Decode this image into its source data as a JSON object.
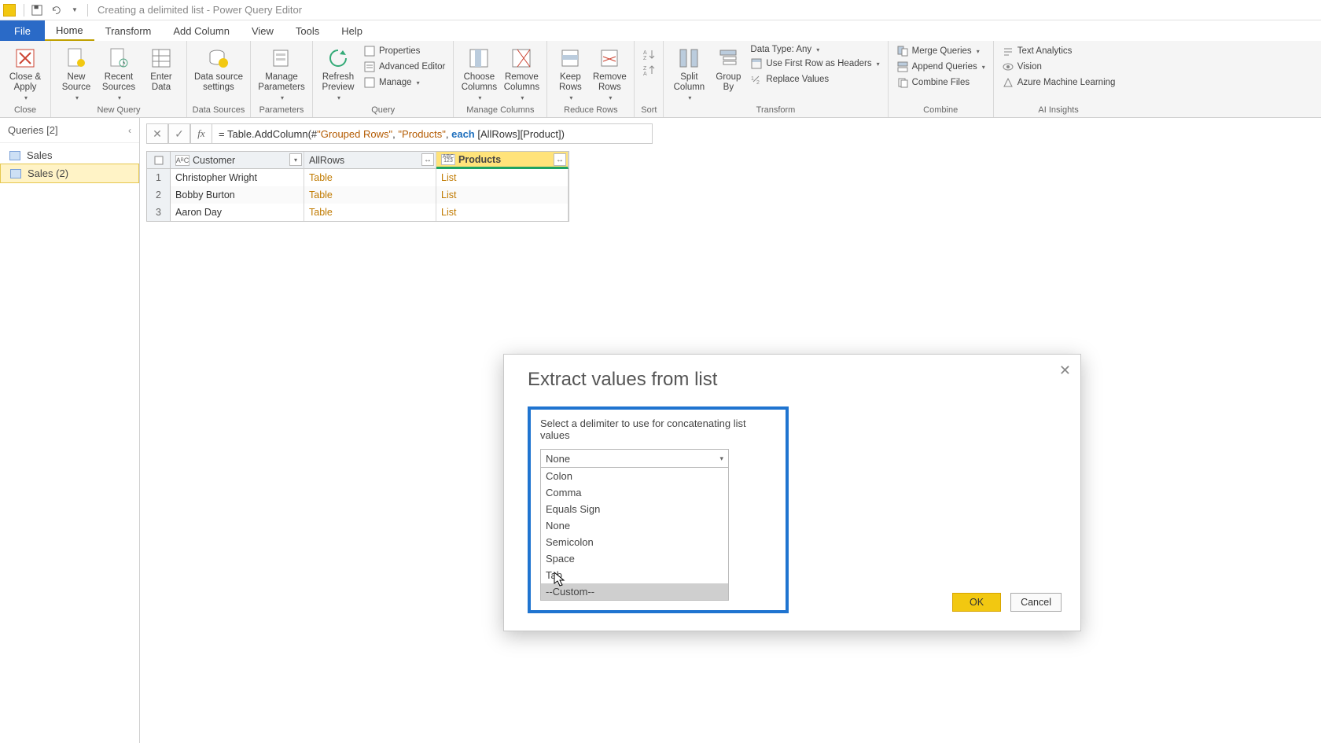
{
  "window": {
    "title": "Creating a delimited list - Power Query Editor"
  },
  "tabs": {
    "file": "File",
    "home": "Home",
    "transform": "Transform",
    "add_column": "Add Column",
    "view": "View",
    "tools": "Tools",
    "help": "Help"
  },
  "ribbon": {
    "close": {
      "close_apply": "Close &\nApply",
      "group": "Close"
    },
    "new_query": {
      "new_source": "New\nSource",
      "recent_sources": "Recent\nSources",
      "enter_data": "Enter\nData",
      "group": "New Query"
    },
    "data_sources": {
      "data_source_settings": "Data source\nsettings",
      "group": "Data Sources"
    },
    "parameters": {
      "manage_parameters": "Manage\nParameters",
      "group": "Parameters"
    },
    "query": {
      "refresh_preview": "Refresh\nPreview",
      "properties": "Properties",
      "advanced_editor": "Advanced Editor",
      "manage": "Manage",
      "group": "Query"
    },
    "manage_columns": {
      "choose_columns": "Choose\nColumns",
      "remove_columns": "Remove\nColumns",
      "group": "Manage Columns"
    },
    "reduce_rows": {
      "keep_rows": "Keep\nRows",
      "remove_rows": "Remove\nRows",
      "group": "Reduce Rows"
    },
    "sort": {
      "group": "Sort"
    },
    "transform": {
      "split_column": "Split\nColumn",
      "group_by": "Group\nBy",
      "data_type": "Data Type: Any",
      "first_row_headers": "Use First Row as Headers",
      "replace_values": "Replace Values",
      "group": "Transform"
    },
    "combine": {
      "merge_queries": "Merge Queries",
      "append_queries": "Append Queries",
      "combine_files": "Combine Files",
      "group": "Combine"
    },
    "ai": {
      "text_analytics": "Text Analytics",
      "vision": "Vision",
      "azure_ml": "Azure Machine Learning",
      "group": "AI Insights"
    }
  },
  "queries_pane": {
    "header": "Queries [2]",
    "items": [
      "Sales",
      "Sales (2)"
    ]
  },
  "formula": {
    "prefix": "= Table.AddColumn(#",
    "arg1": "\"Grouped Rows\"",
    "sep1": ", ",
    "arg2": "\"Products\"",
    "sep2": ", ",
    "kw": "each",
    "tail": " [AllRows][Product])"
  },
  "table": {
    "columns": {
      "customer": "Customer",
      "allrows": "AllRows",
      "products": "Products"
    },
    "type_badges": {
      "customer": "ABC",
      "products": "ABC\n123"
    },
    "rows": [
      {
        "n": "1",
        "customer": "Christopher Wright",
        "allrows": "Table",
        "products": "List"
      },
      {
        "n": "2",
        "customer": "Bobby Burton",
        "allrows": "Table",
        "products": "List"
      },
      {
        "n": "3",
        "customer": "Aaron Day",
        "allrows": "Table",
        "products": "List"
      }
    ]
  },
  "dialog": {
    "title": "Extract values from list",
    "prompt": "Select a delimiter to use for concatenating list values",
    "selected": "None",
    "options": [
      "Colon",
      "Comma",
      "Equals Sign",
      "None",
      "Semicolon",
      "Space",
      "Tab",
      "--Custom--"
    ],
    "ok": "OK",
    "cancel": "Cancel"
  }
}
